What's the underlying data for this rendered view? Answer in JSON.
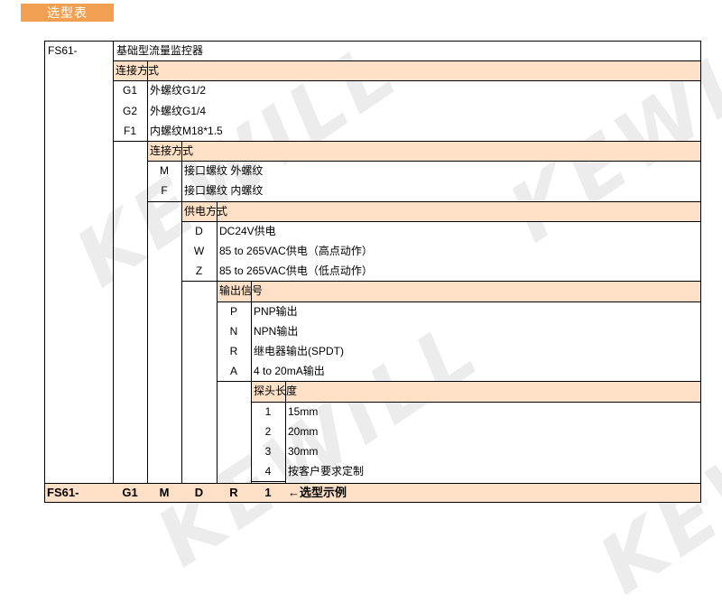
{
  "section_tag": "选型表",
  "watermark": "KEWILL",
  "model": {
    "prefix": "FS61-",
    "name": "基础型流量监控器"
  },
  "groups": [
    {
      "title": "连接方式",
      "options": [
        {
          "code": "G1",
          "desc": "外螺纹G1/2"
        },
        {
          "code": "G2",
          "desc": "外螺纹G1/4"
        },
        {
          "code": "F1",
          "desc": "内螺纹M18*1.5"
        }
      ]
    },
    {
      "title": "连接方式",
      "options": [
        {
          "code": "M",
          "desc": "接口螺纹  外螺纹"
        },
        {
          "code": "F",
          "desc": "接口螺纹  内螺纹"
        }
      ]
    },
    {
      "title": "供电方式",
      "options": [
        {
          "code": "D",
          "desc": "DC24V供电"
        },
        {
          "code": "W",
          "desc": "85 to 265VAC供电（高点动作）"
        },
        {
          "code": "Z",
          "desc": "85 to 265VAC供电（低点动作）"
        }
      ]
    },
    {
      "title": "输出信号",
      "options": [
        {
          "code": "P",
          "desc": "PNP输出"
        },
        {
          "code": "N",
          "desc": "NPN输出"
        },
        {
          "code": "R",
          "desc": "继电器输出(SPDT)"
        },
        {
          "code": "A",
          "desc": "4 to 20mA输出"
        }
      ]
    },
    {
      "title": "探头长度",
      "options": [
        {
          "code": "1",
          "desc": "15mm"
        },
        {
          "code": "2",
          "desc": "20mm"
        },
        {
          "code": "3",
          "desc": "30mm"
        },
        {
          "code": "4",
          "desc": "按客户要求定制"
        }
      ]
    }
  ],
  "example": {
    "codes": [
      "FS61-",
      "G1",
      "M",
      "D",
      "R",
      "1"
    ],
    "label": "←选型示例"
  },
  "colors": {
    "tag": "#f0a050",
    "band": "#fde0c6",
    "watermark": "#ececec"
  }
}
